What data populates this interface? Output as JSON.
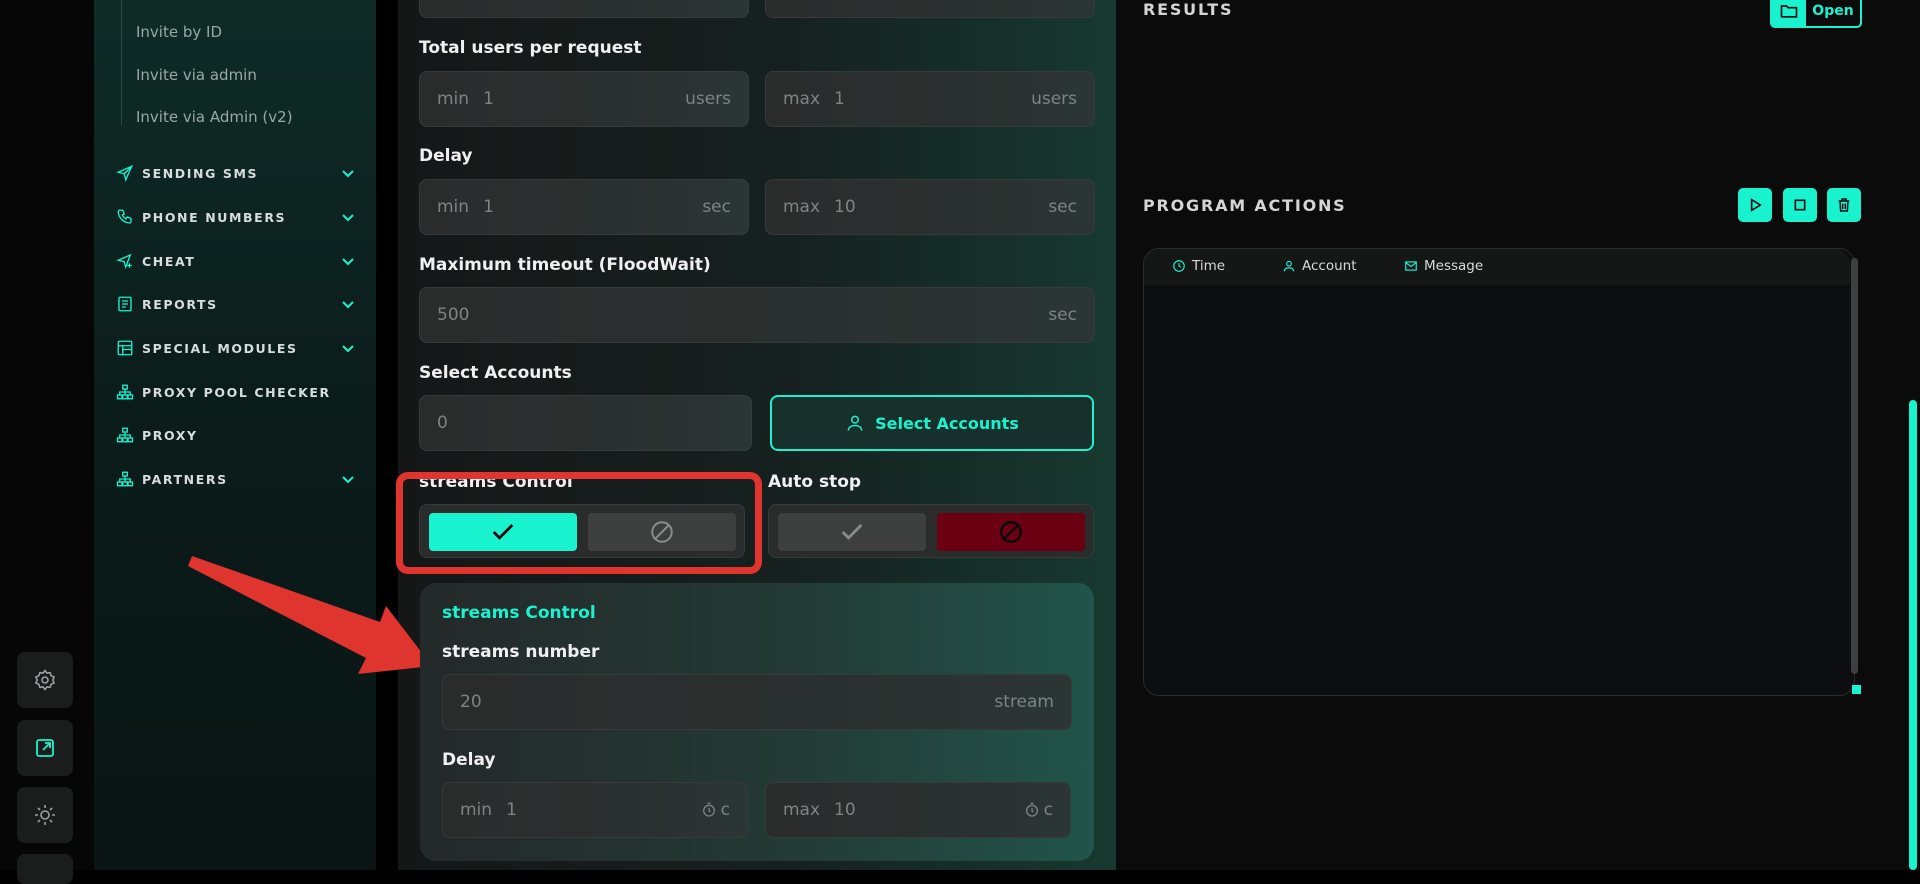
{
  "sidebar": {
    "sub_items": [
      "Invite by ID",
      "Invite via admin",
      "Invite via Admin (v2)"
    ],
    "nav_items": [
      {
        "label": "SENDING SMS",
        "icon": "send-icon",
        "chevron": true
      },
      {
        "label": "PHONE NUMBERS",
        "icon": "phone-icon",
        "chevron": true
      },
      {
        "label": "CHEAT",
        "icon": "send-plus-icon",
        "chevron": true
      },
      {
        "label": "REPORTS",
        "icon": "report-icon",
        "chevron": true
      },
      {
        "label": "SPECIAL MODULES",
        "icon": "table-icon",
        "chevron": true
      },
      {
        "label": "PROXY POOL CHECKER",
        "icon": "network-icon",
        "chevron": false
      },
      {
        "label": "PROXY",
        "icon": "network-icon",
        "chevron": false
      },
      {
        "label": "PARTNERS",
        "icon": "network-icon",
        "chevron": true
      }
    ]
  },
  "rail": {
    "icons": [
      "gear-icon",
      "open-external-icon",
      "sun-icon"
    ]
  },
  "form": {
    "total_users": {
      "label": "Total users per request",
      "min_prefix": "min",
      "min_value": "1",
      "min_suffix": "users",
      "max_prefix": "max",
      "max_value": "1",
      "max_suffix": "users"
    },
    "delay": {
      "label": "Delay",
      "min_prefix": "min",
      "min_value": "1",
      "min_suffix": "sec",
      "max_prefix": "max",
      "max_value": "10",
      "max_suffix": "sec"
    },
    "timeout": {
      "label": "Maximum timeout (FloodWait)",
      "value": "500",
      "suffix": "sec"
    },
    "accounts": {
      "label": "Select Accounts",
      "value": "0",
      "button_label": "Select Accounts"
    },
    "streams_control": {
      "label": "streams Control",
      "enabled": true
    },
    "auto_stop": {
      "label": "Auto stop",
      "enabled": false
    }
  },
  "streams_panel": {
    "title": "streams Control",
    "number_label": "streams number",
    "number_value": "20",
    "number_suffix": "stream",
    "delay_label": "Delay",
    "min_prefix": "min",
    "min_value": "1",
    "min_suffix": "c",
    "max_prefix": "max",
    "max_value": "10",
    "max_suffix": "c"
  },
  "results": {
    "title": "RESULTS",
    "open_label": "Open"
  },
  "program_actions": {
    "title": "PROGRAM ACTIONS",
    "columns": [
      "Time",
      "Account",
      "Message"
    ]
  },
  "colors": {
    "accent": "#19f2cf",
    "danger": "#6b0012",
    "highlight": "#e0342f"
  }
}
